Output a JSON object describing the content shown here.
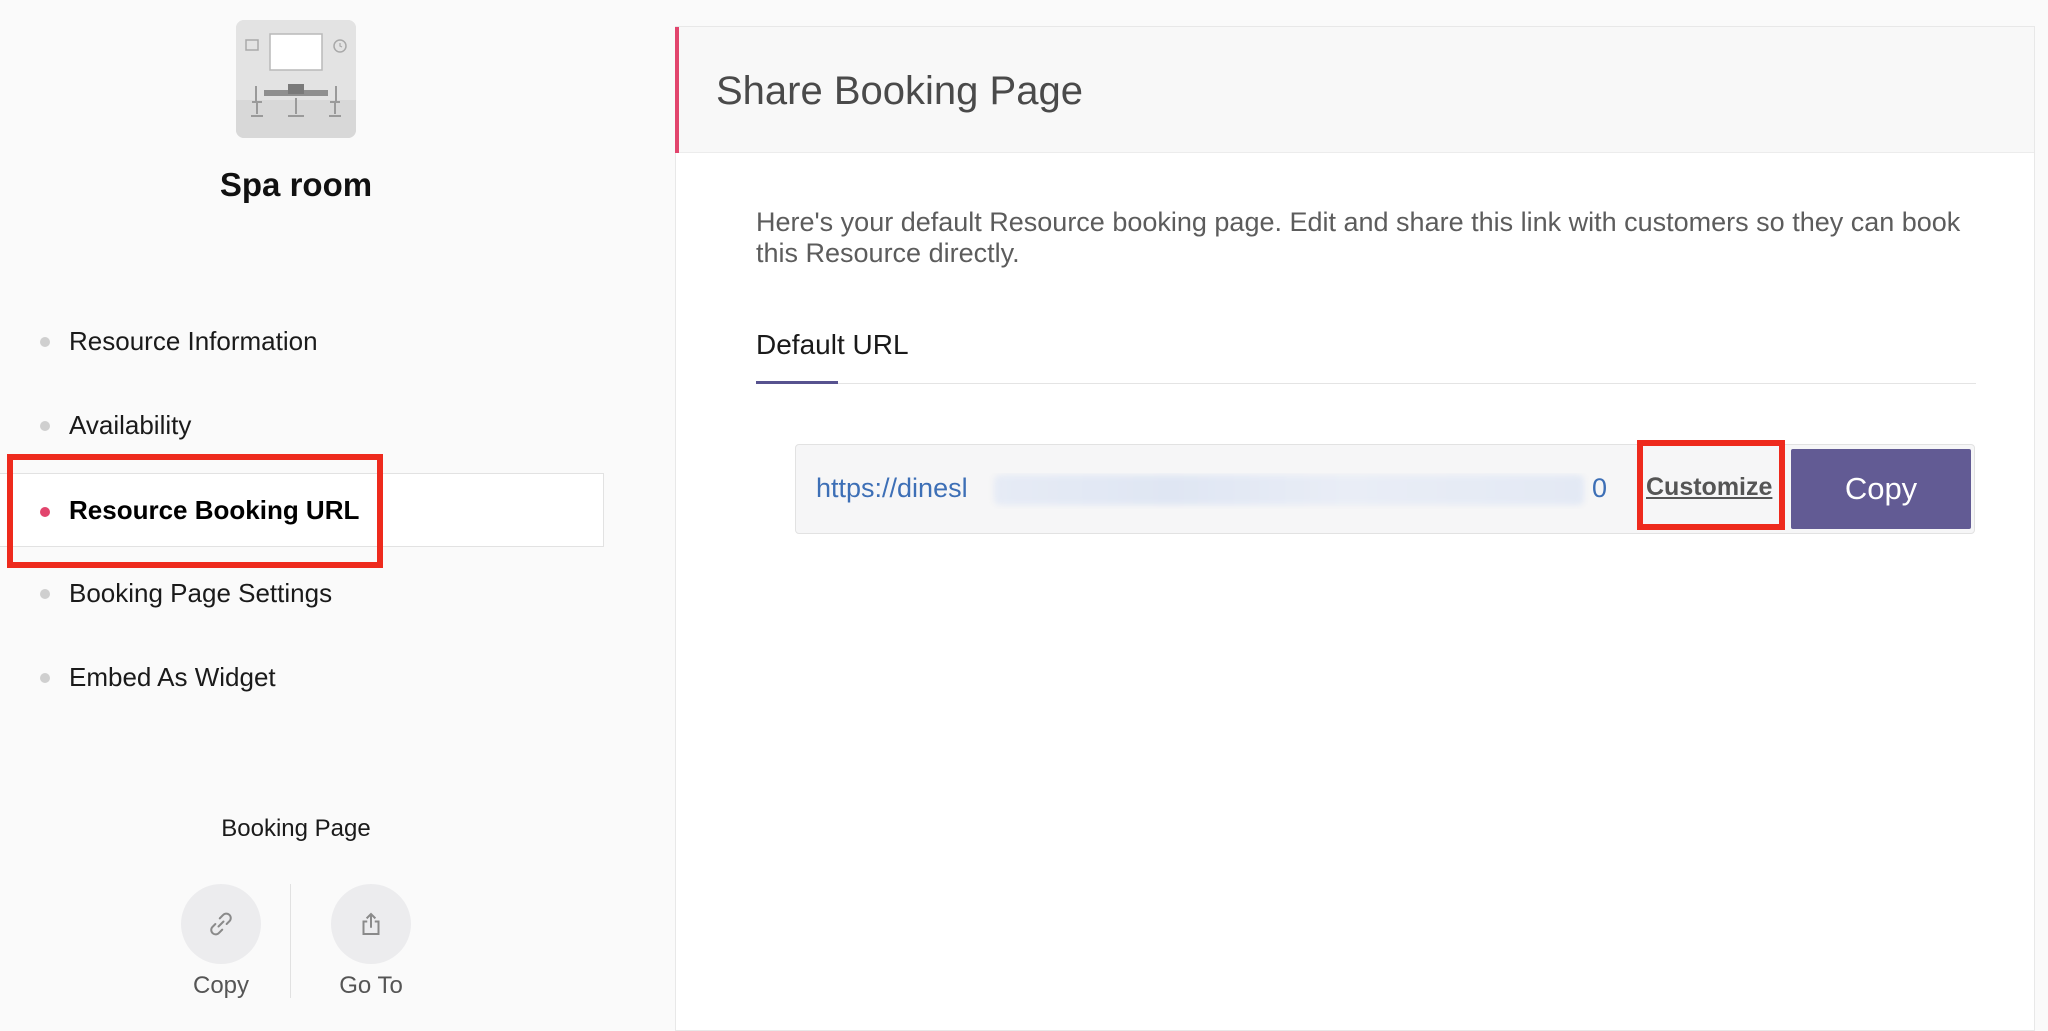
{
  "sidebar": {
    "resource_name": "Spa room",
    "nav_items": [
      {
        "label": "Resource Information",
        "active": false
      },
      {
        "label": "Availability",
        "active": false
      },
      {
        "label": "Resource Booking URL",
        "active": true
      },
      {
        "label": "Booking Page Settings",
        "active": false
      },
      {
        "label": "Embed As Widget",
        "active": false
      }
    ],
    "booking_page": {
      "label": "Booking Page",
      "actions": [
        {
          "label": "Copy",
          "icon": "link-icon"
        },
        {
          "label": "Go To",
          "icon": "share-icon"
        }
      ]
    }
  },
  "main": {
    "title": "Share Booking Page",
    "intro": "Here's your default Resource booking page. Edit and share this link with customers so they can book this Resource directly.",
    "tabs": [
      {
        "label": "Default URL",
        "active": true
      }
    ],
    "url": {
      "visible_start": "https://dinesl",
      "visible_end": "0...",
      "customize_label": "Customize",
      "copy_label": "Copy"
    }
  },
  "colors": {
    "accent": "#e2456d",
    "primary_button": "#625b94",
    "link": "#3d6fb6",
    "highlight": "#ee2a1d"
  }
}
